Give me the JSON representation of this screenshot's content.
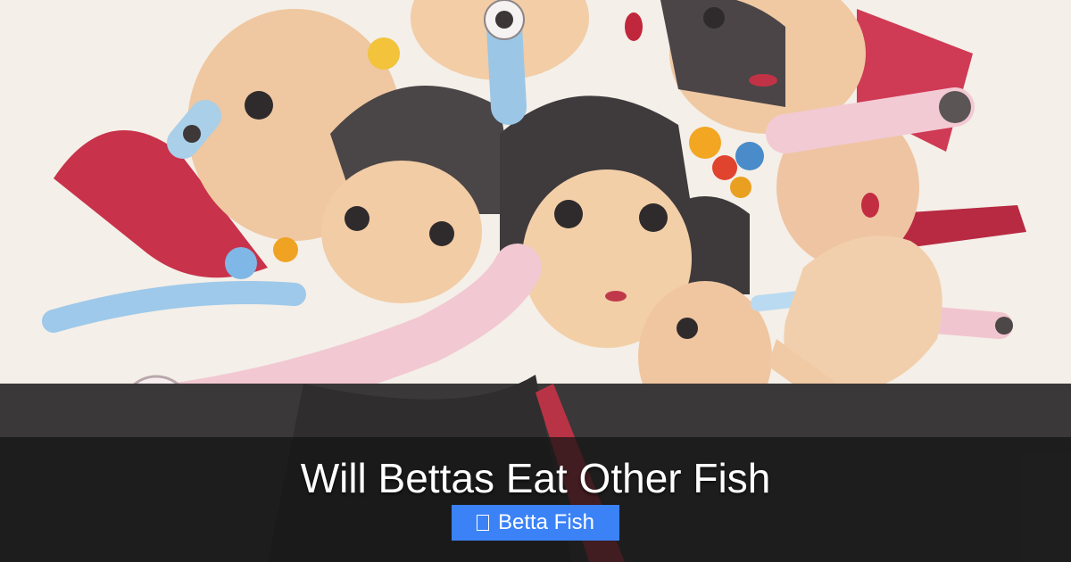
{
  "post": {
    "title": "Will Bettas Eat Other Fish",
    "category": "Betta Fish",
    "category_icon": "missing-glyph-icon"
  },
  "colors": {
    "overlay": "#141414",
    "badge": "#3b82f6",
    "title_text": "#ffffff"
  }
}
